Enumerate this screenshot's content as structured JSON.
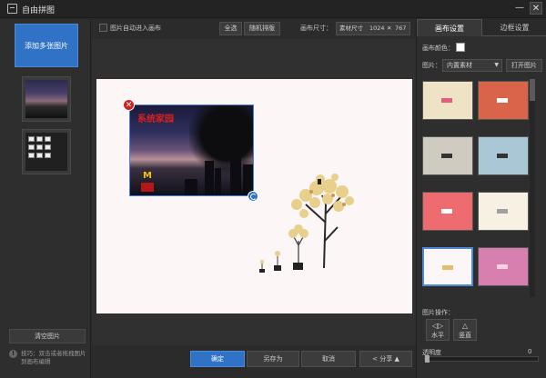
{
  "window": {
    "title": "自由拼图",
    "min_glyph": "—",
    "close_glyph": "✕"
  },
  "left_panel": {
    "add_button": "添加多张图片",
    "clear_button": "清空图片",
    "tip": "技巧：双击或者拖拽图片到画布编辑"
  },
  "toolbar": {
    "auto_canvas_label": "图片自动进入画布",
    "select_all": "全选",
    "random_layout": "随机排版",
    "canvas_size_label": "画布尺寸：",
    "size_mode": "素材尺寸",
    "width": "1024",
    "times": "✕",
    "height": "767"
  },
  "canvas": {
    "photo_caption": "系统家园",
    "mcd_logo": "M"
  },
  "bottom": {
    "ok": "确定",
    "save_as": "另存为",
    "cancel": "取消",
    "share": "分享"
  },
  "right_panel": {
    "tabs": [
      "画布设置",
      "边框设置"
    ],
    "canvas_color_label": "画布颜色：",
    "canvas_color": "#ffffff",
    "image_label": "图片：",
    "image_select": "内置素材",
    "open_image": "打开图片",
    "image_ops_label": "图片操作：",
    "flip_horizontal": "水平",
    "flip_vertical": "竖直",
    "opacity_label": "透明度",
    "opacity_value": "0"
  },
  "materials": [
    {
      "color": "#efe3c6",
      "accent": "#e45c80"
    },
    {
      "color": "#d9644a",
      "accent": "#ffffff"
    },
    {
      "color": "#cfcbc0",
      "accent": "#333333"
    },
    {
      "color": "#a9c7d4",
      "accent": "#333333"
    },
    {
      "color": "#ee6b70",
      "accent": "#ffffff"
    },
    {
      "color": "#f6f1e3",
      "accent": "#a0a0a0"
    },
    {
      "color": "#fdf6f6",
      "accent": "#e0c070"
    },
    {
      "color": "#d77fae",
      "accent": "#f4d0e3"
    }
  ]
}
